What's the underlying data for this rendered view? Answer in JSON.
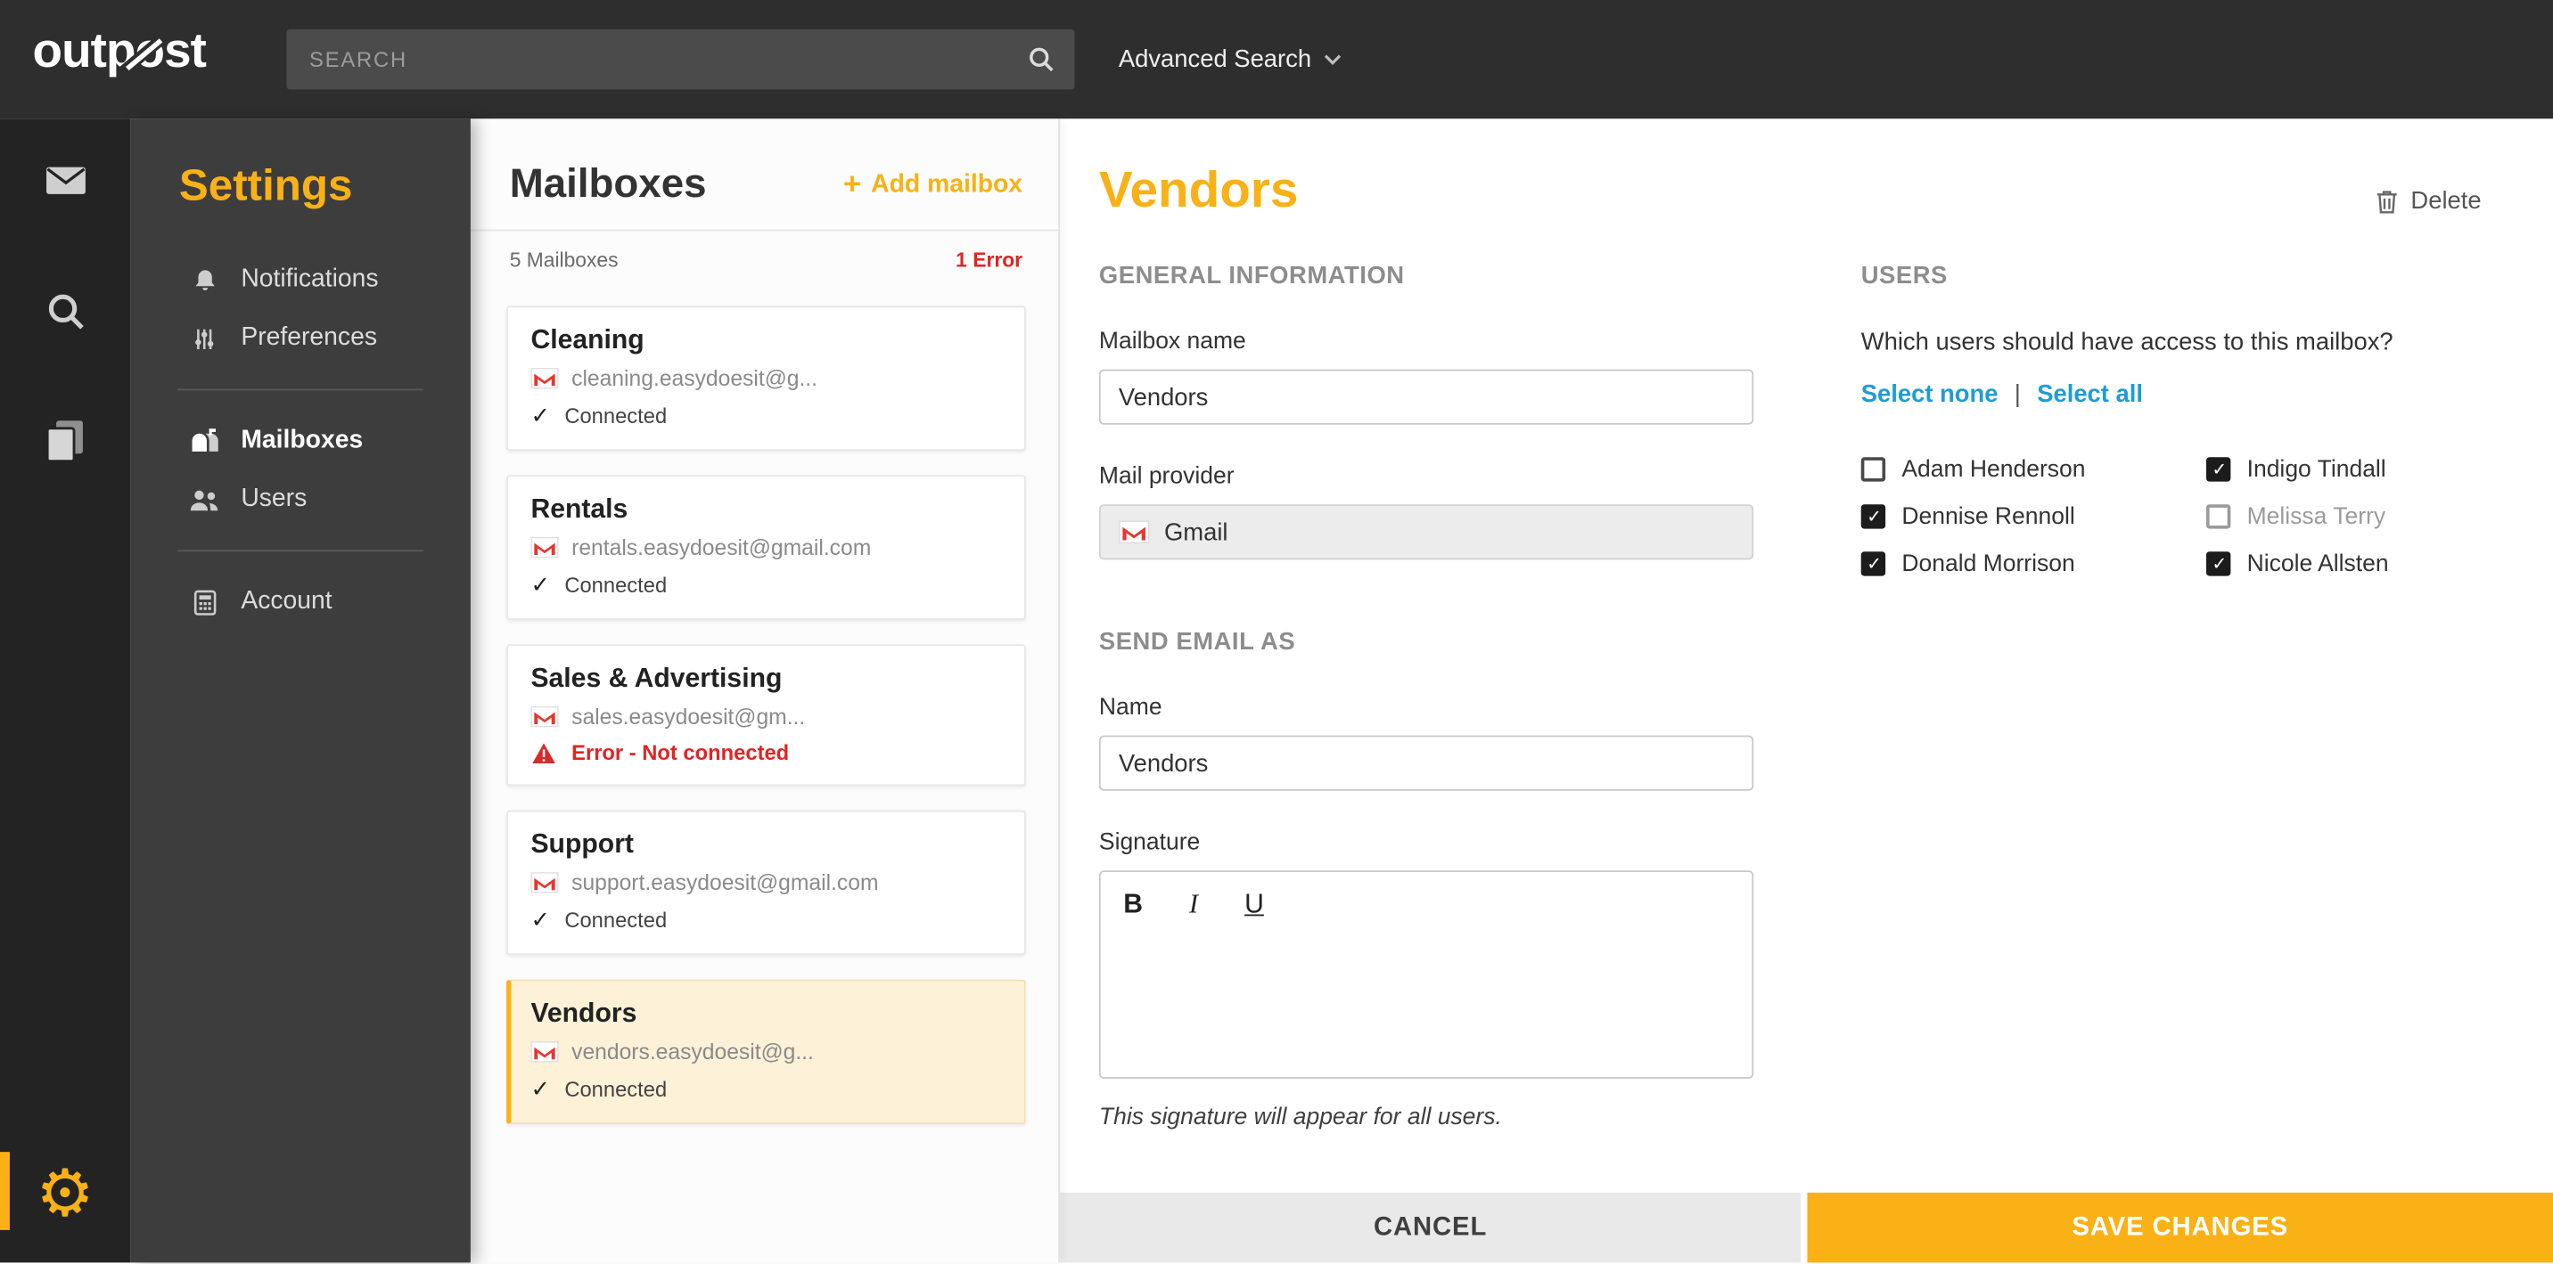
{
  "topbar": {
    "logo": "outpost",
    "search_placeholder": "SEARCH",
    "advanced_search_label": "Advanced Search"
  },
  "sidebar": {
    "title": "Settings",
    "items": [
      {
        "label": "Notifications"
      },
      {
        "label": "Preferences"
      },
      {
        "label": "Mailboxes",
        "active": true
      },
      {
        "label": "Users"
      },
      {
        "label": "Account"
      }
    ]
  },
  "panel": {
    "title": "Mailboxes",
    "add_mailbox_label": "Add mailbox",
    "count_label": "5 Mailboxes",
    "error_count_label": "1 Error",
    "cards": [
      {
        "name": "Cleaning",
        "email": "cleaning.easydoesit@g...",
        "status": "Connected",
        "error": false,
        "selected": false
      },
      {
        "name": "Rentals",
        "email": "rentals.easydoesit@gmail.com",
        "status": "Connected",
        "error": false,
        "selected": false
      },
      {
        "name": "Sales & Advertising",
        "email": "sales.easydoesit@gm...",
        "status": "Error - Not connected",
        "error": true,
        "selected": false
      },
      {
        "name": "Support",
        "email": "support.easydoesit@gmail.com",
        "status": "Connected",
        "error": false,
        "selected": false
      },
      {
        "name": "Vendors",
        "email": "vendors.easydoesit@g...",
        "status": "Connected",
        "error": false,
        "selected": true
      }
    ]
  },
  "main": {
    "title": "Vendors",
    "delete_label": "Delete",
    "sections": {
      "general": "GENERAL INFORMATION",
      "send_as": "SEND EMAIL AS",
      "users": "USERS"
    },
    "fields": {
      "mailbox_name": {
        "label": "Mailbox name",
        "value": "Vendors"
      },
      "mail_provider": {
        "label": "Mail provider",
        "value": "Gmail"
      },
      "name": {
        "label": "Name",
        "value": "Vendors"
      },
      "signature": {
        "label": "Signature",
        "note": "This signature will appear for all users."
      }
    },
    "editor": {
      "bold": "B",
      "italic": "I",
      "underline": "U"
    },
    "users": {
      "question": "Which users should have access to this mailbox?",
      "select_none": "Select none",
      "separator": "|",
      "select_all": "Select all",
      "list": [
        {
          "name": "Adam Henderson",
          "checked": false,
          "muted": false
        },
        {
          "name": "Dennise Rennoll",
          "checked": true,
          "muted": false
        },
        {
          "name": "Donald Morrison",
          "checked": true,
          "muted": false
        },
        {
          "name": "Indigo Tindall",
          "checked": true,
          "muted": false
        },
        {
          "name": "Melissa Terry",
          "checked": false,
          "muted": true
        },
        {
          "name": "Nicole Allsten",
          "checked": true,
          "muted": false
        }
      ]
    },
    "actions": {
      "cancel": "CANCEL",
      "save": "SAVE CHANGES"
    }
  },
  "icons": {
    "plus": "+",
    "gear": "⚙",
    "check": "✓"
  },
  "colors": {
    "accent": "#f9b116",
    "link": "#1e9cd7",
    "error": "#e02424",
    "selected_card_bg": "#fdf1d7",
    "topbar_bg": "#2e2e2e",
    "rail_bg": "#232323",
    "sidebar_bg": "#3d3d3d"
  }
}
